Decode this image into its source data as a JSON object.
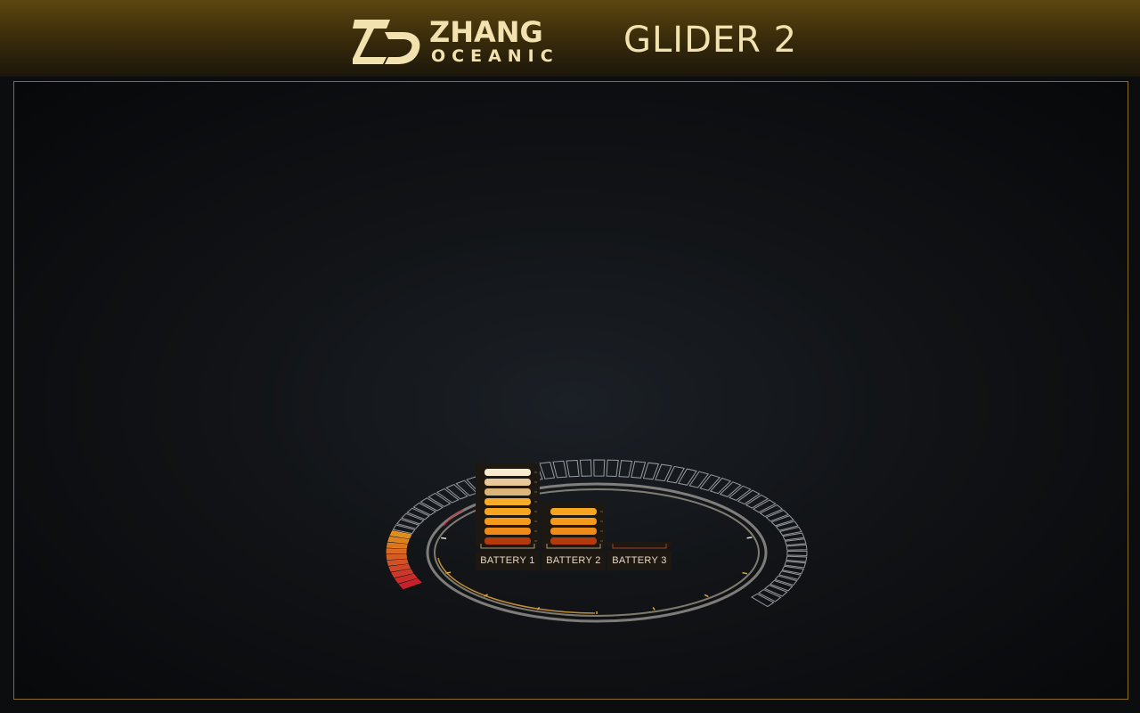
{
  "header": {
    "brand": "ZHANG",
    "brand_sub": "OCEANIC",
    "product": "GLIDER 2"
  },
  "colors": {
    "accent": "#f2e2b0",
    "frame": "#8a6c22",
    "ring": "#e0dcd2",
    "gauge_warm": "#f39a1e",
    "gauge_hot": "#d8232f"
  },
  "batteries": [
    {
      "label": "BATTERY 1",
      "level": 8,
      "max": 8
    },
    {
      "label": "BATTERY 2",
      "level": 4,
      "max": 8
    },
    {
      "label": "BATTERY 3",
      "level": 0,
      "max": 8
    }
  ],
  "gauge": {
    "segments_total": 64,
    "segments_lit": 10
  }
}
